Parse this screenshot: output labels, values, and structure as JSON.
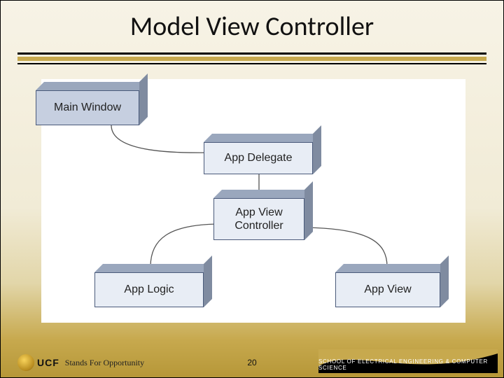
{
  "title": "Model View Controller",
  "boxes": {
    "main_window": "Main Window",
    "app_delegate": "App Delegate",
    "app_view_controller": "App View\nController",
    "app_logic": "App Logic",
    "app_view": "App View"
  },
  "connections": [
    [
      "main_window",
      "app_delegate"
    ],
    [
      "app_delegate",
      "app_view_controller"
    ],
    [
      "app_view_controller",
      "app_logic"
    ],
    [
      "app_view_controller",
      "app_view"
    ]
  ],
  "footer": {
    "org_abbrev": "UCF",
    "tagline": "Stands For Opportunity",
    "school": "SCHOOL OF ELECTRICAL ENGINEERING & COMPUTER SCIENCE",
    "page_number": "20"
  }
}
